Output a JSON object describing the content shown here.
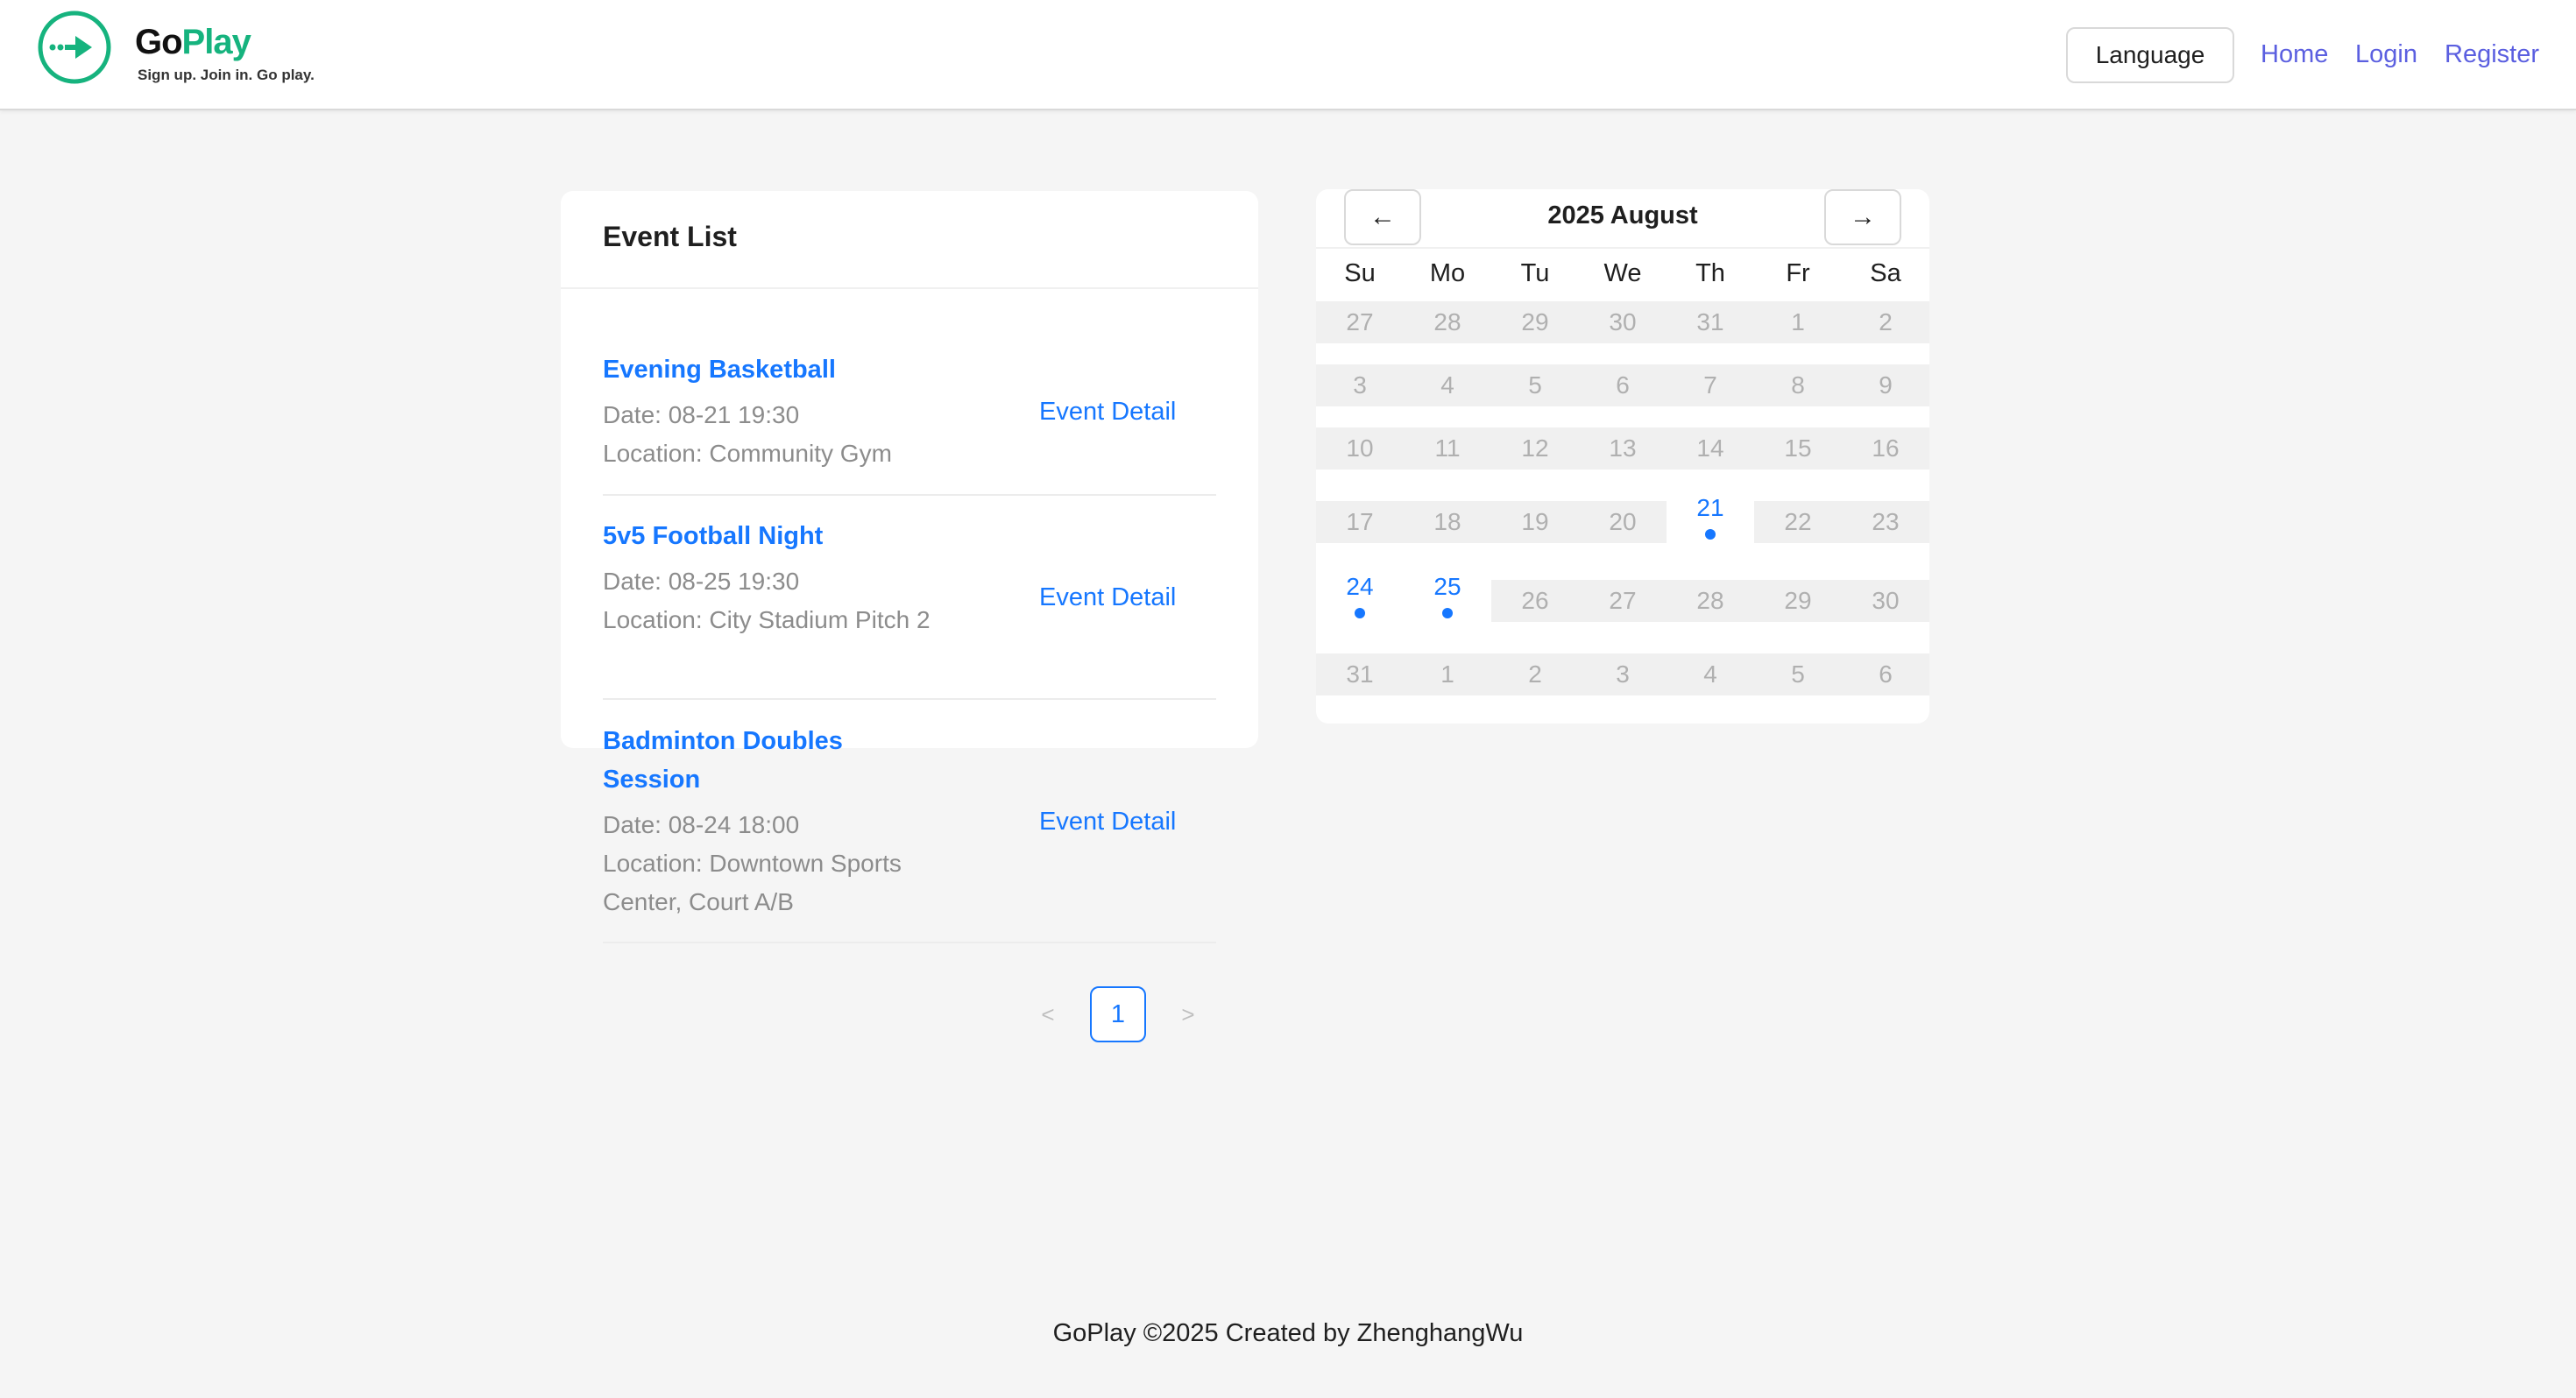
{
  "header": {
    "logo_go": "Go",
    "logo_play": "Play",
    "tagline": "Sign up. Join in. Go play.",
    "language_label": "Language",
    "nav": {
      "home": "Home",
      "login": "Login",
      "register": "Register"
    }
  },
  "event_list": {
    "title": "Event List",
    "events": [
      {
        "title": "Evening Basketball",
        "date": "Date: 08-21 19:30",
        "location": "Location: Community Gym",
        "detail_label": "Event Detail"
      },
      {
        "title": "5v5 Football Night",
        "date": "Date: 08-25 19:30",
        "location": "Location: City Stadium Pitch 2",
        "detail_label": "Event Detail"
      },
      {
        "title": "Badminton Doubles Session",
        "date": "Date: 08-24 18:00",
        "location": "Location: Downtown Sports Center, Court A/B",
        "detail_label": "Event Detail"
      }
    ]
  },
  "pagination": {
    "prev": "<",
    "current_page": "1",
    "next": ">"
  },
  "calendar": {
    "prev_icon": "←",
    "next_icon": "→",
    "title": "2025 August",
    "weekdays": [
      "Su",
      "Mo",
      "Tu",
      "We",
      "Th",
      "Fr",
      "Sa"
    ],
    "weeks": [
      [
        "27",
        "28",
        "29",
        "30",
        "31",
        "1",
        "2"
      ],
      [
        "3",
        "4",
        "5",
        "6",
        "7",
        "8",
        "9"
      ],
      [
        "10",
        "11",
        "12",
        "13",
        "14",
        "15",
        "16"
      ],
      [
        "17",
        "18",
        "19",
        "20",
        "21",
        "22",
        "23"
      ],
      [
        "24",
        "25",
        "26",
        "27",
        "28",
        "29",
        "30"
      ],
      [
        "31",
        "1",
        "2",
        "3",
        "4",
        "5",
        "6"
      ]
    ],
    "event_days": [
      "21",
      "24",
      "25"
    ]
  },
  "footer": {
    "text": "GoPlay ©2025 Created by ZhenghangWu"
  },
  "colors": {
    "brand_green": "#16b37e",
    "link_blue": "#1677ff",
    "nav_purple": "#5b5fe0"
  }
}
